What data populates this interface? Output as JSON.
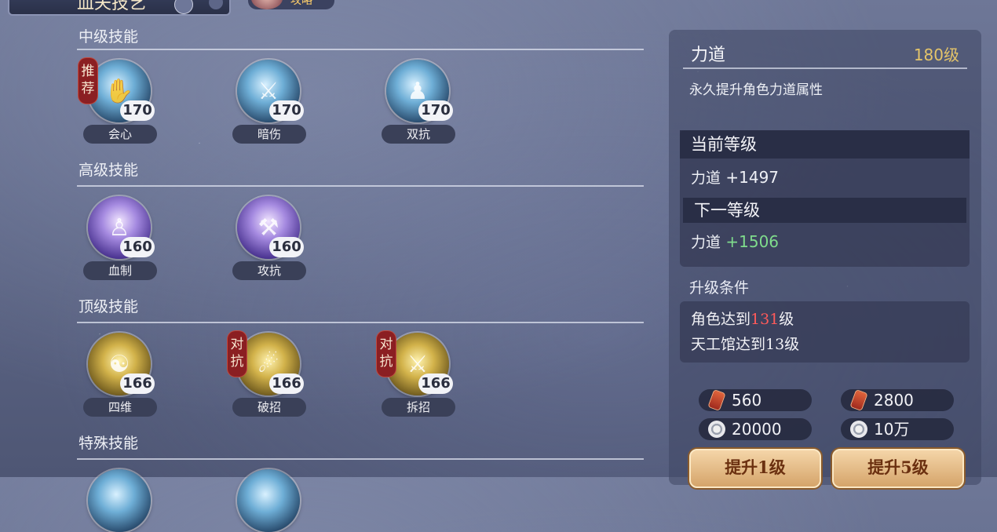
{
  "top": {
    "title": "血夫技艺",
    "role": "攻略"
  },
  "sections": [
    {
      "title": "中级技能",
      "skills": [
        {
          "name": "会心",
          "level": "170",
          "tag": "推荐"
        },
        {
          "name": "暗伤",
          "level": "170"
        },
        {
          "name": "双抗",
          "level": "170"
        }
      ]
    },
    {
      "title": "高级技能",
      "skills": [
        {
          "name": "血制",
          "level": "160"
        },
        {
          "name": "攻抗",
          "level": "160"
        }
      ]
    },
    {
      "title": "顶级技能",
      "skills": [
        {
          "name": "四维",
          "level": "166"
        },
        {
          "name": "破招",
          "level": "166",
          "tag": "对抗"
        },
        {
          "name": "拆招",
          "level": "166",
          "tag": "对抗"
        }
      ]
    },
    {
      "title": "特殊技能",
      "skills": []
    }
  ],
  "detail": {
    "name": "力道",
    "level": "180级",
    "description": "永久提升角色力道属性",
    "current_header": "当前等级",
    "current_key": "力道",
    "current_value": "+1497",
    "next_header": "下一等级",
    "next_key": "力道",
    "next_value": "+1506",
    "req_title": "升级条件",
    "req1_prefix": "角色达到",
    "req1_level": "131",
    "req1_suffix": "级",
    "req2": "天工馆达到13级",
    "cost_scroll_1": "560",
    "cost_coin_1": "20000",
    "cost_scroll_5": "2800",
    "cost_coin_5": "10万",
    "btn_up1": "提升1级",
    "btn_up5": "提升5级"
  },
  "colors": {
    "level_gold": "#e4c46a",
    "next_green": "#7fdc8c",
    "req_red": "#ff5a5a",
    "tag_red": "#8b1f22"
  }
}
